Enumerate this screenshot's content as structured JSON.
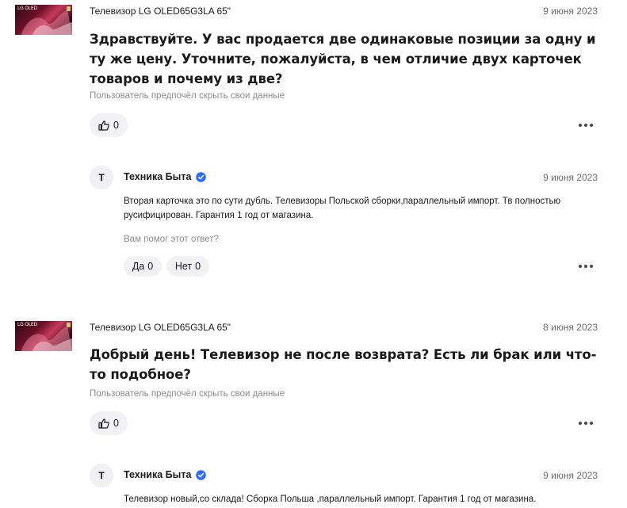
{
  "questions": [
    {
      "thumb_label": "LG OLED",
      "product": "Телевизор LG OLED65G3LA 65\"",
      "date": "9 июня 2023",
      "text": "Здравствуйте. У вас продается две одинаковые позиции за одну и ту же цену. Уточните, пожалуйста, в чем отличие двух карточек товаров и почему из две?",
      "author_note": "Пользователь предпочёл скрыть свои данные",
      "likes": "0",
      "answer": {
        "avatar_letter": "Т",
        "seller": "Техника Быта",
        "date": "9 июня 2023",
        "text": "Вторая карточка это по сути дубль. Телевизоры Польской сборки,параллельный импорт. Тв полностью русифицирован. Гарантия 1 год от магазина.",
        "helpful_question": "Вам помог этот ответ?",
        "yes_label": "Да",
        "yes_count": "0",
        "no_label": "Нет",
        "no_count": "0"
      }
    },
    {
      "thumb_label": "LG OLED",
      "product": "Телевизор LG OLED65G3LA 65\"",
      "date": "8 июня 2023",
      "text": "Добрый день! Телевизор не после возврата? Есть ли брак или что-то подобное?",
      "author_note": "Пользователь предпочёл скрыть свои данные",
      "likes": "0",
      "answer": {
        "avatar_letter": "Т",
        "seller": "Техника Быта",
        "date": "9 июня 2023",
        "text": "Телевизор новый,со склада! Сборка Польша ,параллельный импорт. Гарантия 1 год от магазина."
      }
    }
  ],
  "icons": {
    "like": "thumbs-up-icon",
    "more": "more-dots-icon",
    "verified": "verified-check-icon"
  },
  "colors": {
    "verified": "#2f6bff",
    "muted_text": "#8c8c8c",
    "pill_bg": "#f2f2f4"
  }
}
